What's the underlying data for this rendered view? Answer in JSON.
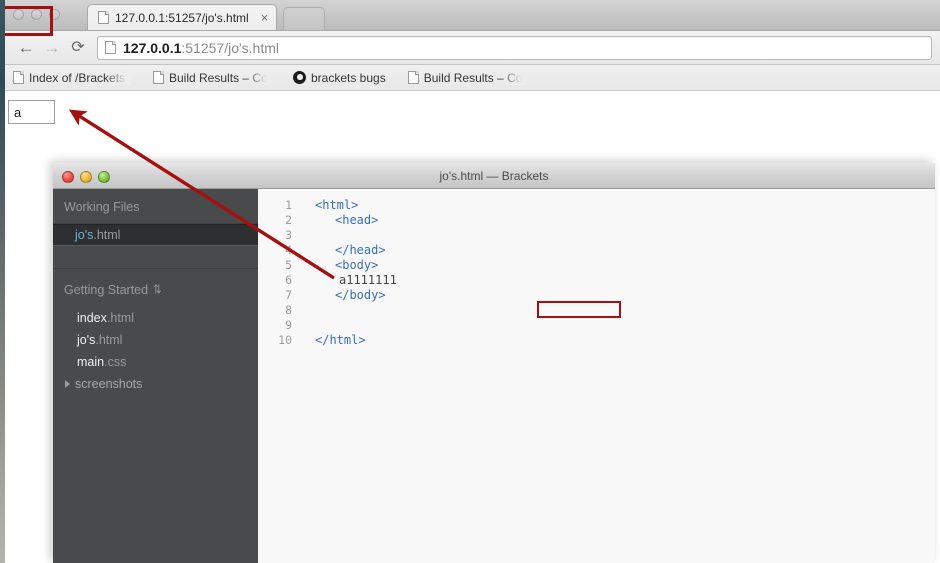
{
  "browser": {
    "traffic_lights": [
      "close",
      "minimize",
      "zoom"
    ],
    "tab": {
      "title": "127.0.0.1:51257/jo's.html",
      "close_label": "×",
      "icon": "page-icon"
    },
    "nav": {
      "back_label": "←",
      "forward_label": "→",
      "reload_label": "⟳"
    },
    "omnibox": {
      "url_host": "127.0.0.1",
      "url_rest": ":51257/jo's.html",
      "icon": "page-icon"
    },
    "bookmarks": [
      {
        "label": "Index of /Brackets_B",
        "icon": "page-icon"
      },
      {
        "label": "Build Results – Code",
        "icon": "page-icon"
      },
      {
        "label": "brackets bugs",
        "icon": "github-icon"
      },
      {
        "label": "Build Results – Code",
        "icon": "page-icon"
      }
    ]
  },
  "page": {
    "input_value": "a",
    "input_placeholder": ""
  },
  "brackets": {
    "title": "jo's.html — Brackets",
    "traffic_lights": [
      "close",
      "minimize",
      "zoom"
    ],
    "sidebar": {
      "working_files_title": "Working Files",
      "working_files": [
        {
          "name": "jo's",
          "ext": ".html",
          "selected": true
        }
      ],
      "project_title": "Getting Started",
      "sort_glyph": "⇅",
      "tree": [
        {
          "name": "index",
          "ext": ".html",
          "type": "file"
        },
        {
          "name": "jo's",
          "ext": ".html",
          "type": "file"
        },
        {
          "name": "main",
          "ext": ".css",
          "type": "file"
        },
        {
          "name": "screenshots",
          "ext": "",
          "type": "folder"
        }
      ]
    },
    "editor": {
      "lines": [
        {
          "num": "1",
          "text": "<html>",
          "indent": 0,
          "kind": "tag"
        },
        {
          "num": "2",
          "text": "<head>",
          "indent": 1,
          "kind": "tag"
        },
        {
          "num": "3",
          "text": "",
          "indent": 0,
          "kind": "tag"
        },
        {
          "num": "4",
          "text": "</head>",
          "indent": 1,
          "kind": "tag"
        },
        {
          "num": "5",
          "text": "<body>",
          "indent": 1,
          "kind": "tag"
        },
        {
          "num": "6",
          "text": "a1111111",
          "indent": 1,
          "kind": "text"
        },
        {
          "num": "7",
          "text": "</body>",
          "indent": 1,
          "kind": "tag"
        },
        {
          "num": "8",
          "text": "",
          "indent": 0,
          "kind": "tag"
        },
        {
          "num": "9",
          "text": "",
          "indent": 0,
          "kind": "tag"
        },
        {
          "num": "10",
          "text": "</html>",
          "indent": 0,
          "kind": "tag"
        }
      ]
    }
  },
  "annotation": {
    "arrow_color": "#a50f0f",
    "highlight_color": "#a50f0f",
    "from_label": "a1111111",
    "to_label": "a"
  }
}
